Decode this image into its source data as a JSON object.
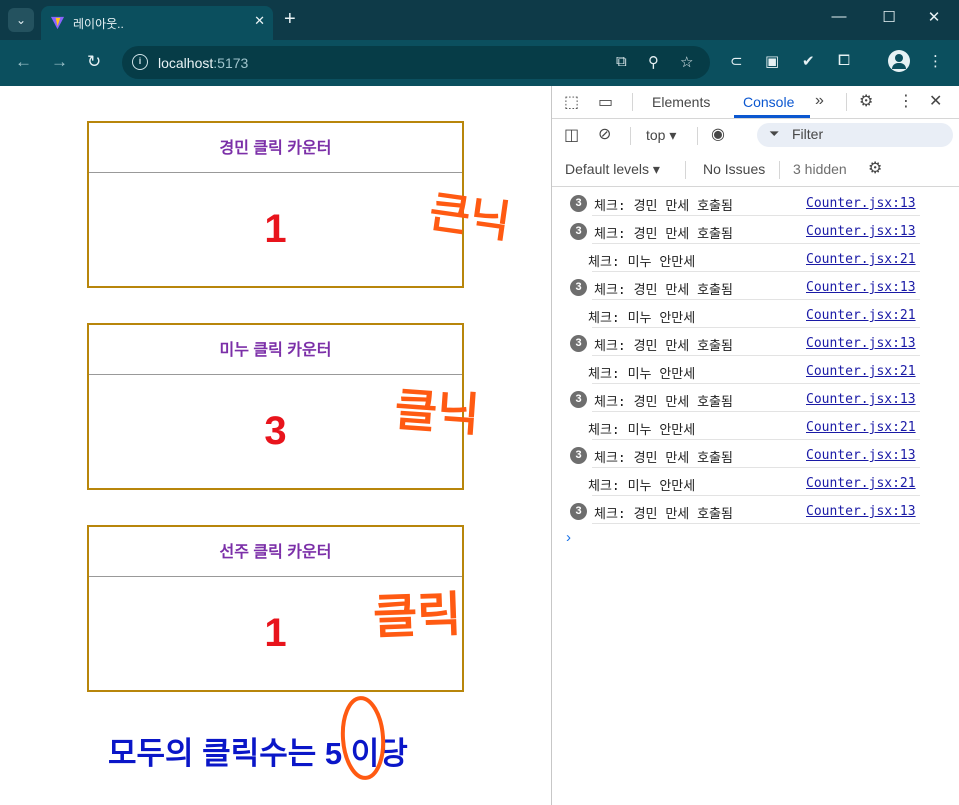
{
  "browser": {
    "tab_title": "레이아웃..",
    "tab_close": "✕",
    "new_tab": "+",
    "url_host": "localhost",
    "url_port": ":5173",
    "window_controls": [
      "—",
      "☐",
      "✕"
    ]
  },
  "page": {
    "cards": [
      {
        "title": "경민 클릭 카운터",
        "count": "1"
      },
      {
        "title": "미누 클릭 카운터",
        "count": "3"
      },
      {
        "title": "선주 클릭 카운터",
        "count": "1"
      }
    ],
    "total_prefix": "모두의 클릭수는 ",
    "total_value": "5",
    "total_suffix": " 이당",
    "annotations": [
      "큰닉",
      "클닉",
      "클릭"
    ]
  },
  "devtools": {
    "tabs": [
      "Elements",
      "Console"
    ],
    "active_tab": "Console",
    "context": "top",
    "filter_placeholder": "Filter",
    "levels": "Default levels",
    "issues": "No Issues",
    "hidden": "3 hidden",
    "logs": [
      {
        "count": "3",
        "text": "체크: 경민 만세 호출됨",
        "source": "Counter.jsx:13"
      },
      {
        "count": "3",
        "text": "체크: 경민 만세 호출됨",
        "source": "Counter.jsx:13"
      },
      {
        "count": "",
        "text": "체크: 미누 안만세",
        "source": "Counter.jsx:21"
      },
      {
        "count": "3",
        "text": "체크: 경민 만세 호출됨",
        "source": "Counter.jsx:13"
      },
      {
        "count": "",
        "text": "체크: 미누 안만세",
        "source": "Counter.jsx:21"
      },
      {
        "count": "3",
        "text": "체크: 경민 만세 호출됨",
        "source": "Counter.jsx:13"
      },
      {
        "count": "",
        "text": "체크: 미누 안만세",
        "source": "Counter.jsx:21"
      },
      {
        "count": "3",
        "text": "체크: 경민 만세 호출됨",
        "source": "Counter.jsx:13"
      },
      {
        "count": "",
        "text": "체크: 미누 안만세",
        "source": "Counter.jsx:21"
      },
      {
        "count": "3",
        "text": "체크: 경민 만세 호출됨",
        "source": "Counter.jsx:13"
      },
      {
        "count": "",
        "text": "체크: 미누 안만세",
        "source": "Counter.jsx:21"
      },
      {
        "count": "3",
        "text": "체크: 경민 만세 호출됨",
        "source": "Counter.jsx:13"
      }
    ]
  },
  "colors": {
    "card_border": "#b8860b",
    "card_title": "#7b2fa8",
    "count": "#e8141c",
    "total": "#0a16c8",
    "annotation": "#ff5a12",
    "chrome": "#0b4f5e"
  }
}
